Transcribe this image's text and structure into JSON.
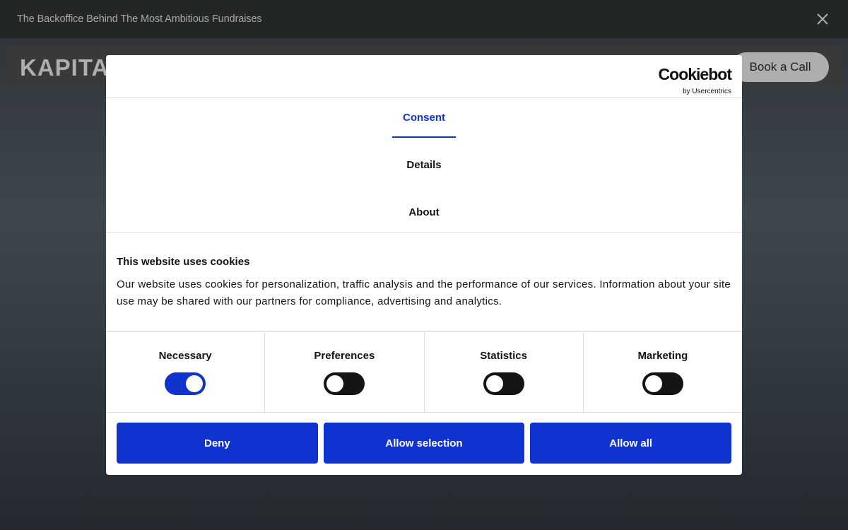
{
  "announcement": {
    "text": "The Backoffice Behind The Most Ambitious Fundraises"
  },
  "nav": {
    "logo": "KAPITA",
    "book_call": "Book a Call"
  },
  "cookie_dialog": {
    "brand": {
      "main": "Cookiebot",
      "sub": "by Usercentrics"
    },
    "tabs": [
      {
        "label": "Consent",
        "active": true
      },
      {
        "label": "Details",
        "active": false
      },
      {
        "label": "About",
        "active": false
      }
    ],
    "title": "This website uses cookies",
    "body": "Our website uses cookies for personalization, traffic analysis and the performance of our services. Information about your site use may be shared with our partners for compliance, advertising and analytics.",
    "toggles": [
      {
        "label": "Necessary",
        "checked": true
      },
      {
        "label": "Preferences",
        "checked": false
      },
      {
        "label": "Statistics",
        "checked": false
      },
      {
        "label": "Marketing",
        "checked": false
      }
    ],
    "buttons": {
      "deny": "Deny",
      "allow_selection": "Allow selection",
      "allow_all": "Allow all"
    }
  },
  "colors": {
    "accent": "#1032cf",
    "toggle_off": "#141414",
    "announcement_bg": "#2c2e2c"
  }
}
